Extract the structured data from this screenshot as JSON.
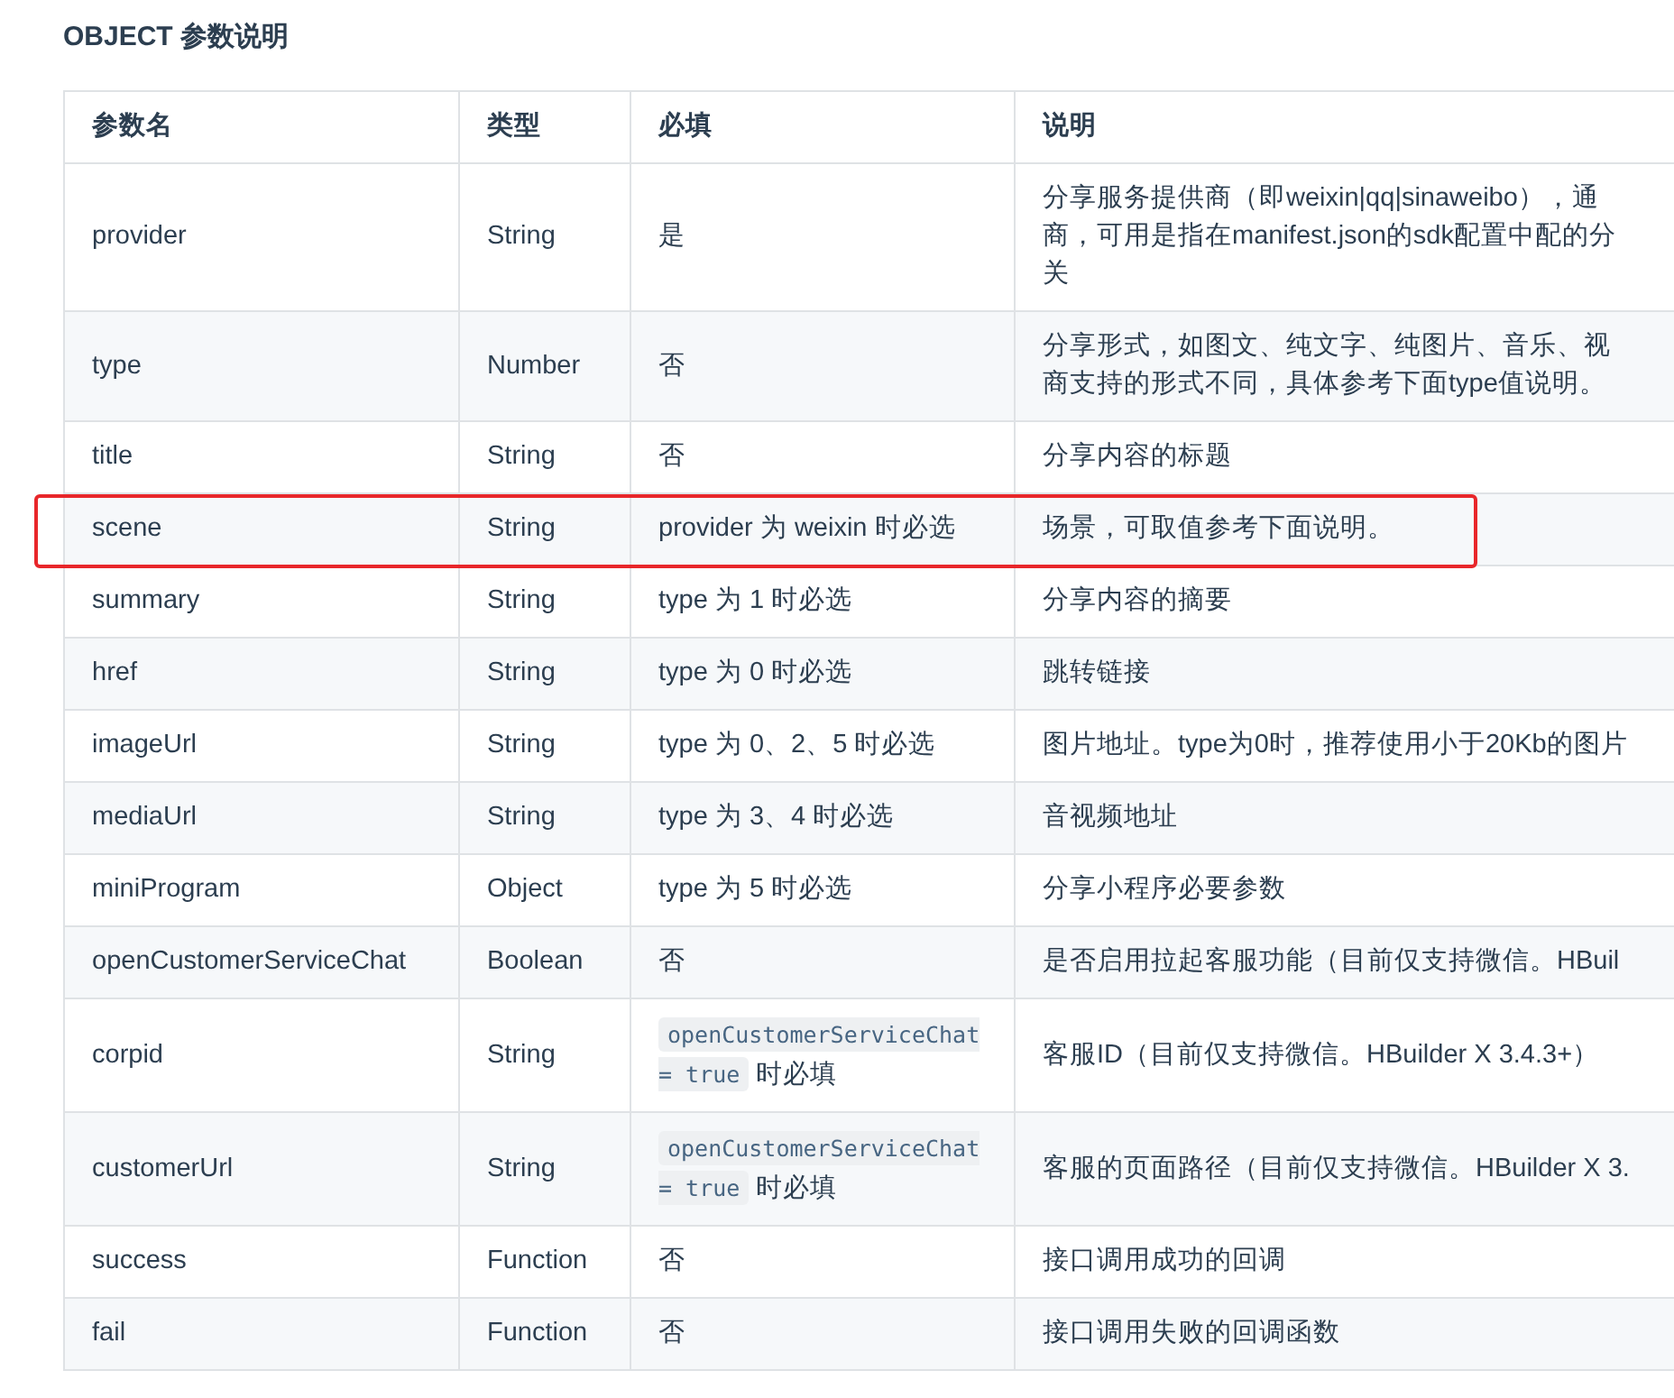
{
  "title": "OBJECT 参数说明",
  "columns": [
    "参数名",
    "类型",
    "必填",
    "说明"
  ],
  "rows": [
    {
      "name": "provider",
      "type": "String",
      "required": {
        "kind": "text",
        "text": "是"
      },
      "description": [
        "分享服务提供商（即weixin|qq|sinaweibo），通",
        "商，可用是指在manifest.json的sdk配置中配的分",
        "关"
      ],
      "highlighted": false
    },
    {
      "name": "type",
      "type": "Number",
      "required": {
        "kind": "text",
        "text": "否"
      },
      "description": [
        "分享形式，如图文、纯文字、纯图片、音乐、视",
        "商支持的形式不同，具体参考下面type值说明。"
      ],
      "highlighted": false
    },
    {
      "name": "title",
      "type": "String",
      "required": {
        "kind": "text",
        "text": "否"
      },
      "description": [
        "分享内容的标题"
      ],
      "highlighted": false
    },
    {
      "name": "scene",
      "type": "String",
      "required": {
        "kind": "text",
        "text": "provider 为 weixin 时必选"
      },
      "description": [
        "场景，可取值参考下面说明。"
      ],
      "highlighted": true
    },
    {
      "name": "summary",
      "type": "String",
      "required": {
        "kind": "text",
        "text": "type 为 1 时必选"
      },
      "description": [
        "分享内容的摘要"
      ],
      "highlighted": false
    },
    {
      "name": "href",
      "type": "String",
      "required": {
        "kind": "text",
        "text": "type 为 0 时必选"
      },
      "description": [
        "跳转链接"
      ],
      "highlighted": false
    },
    {
      "name": "imageUrl",
      "type": "String",
      "required": {
        "kind": "text",
        "text": "type 为 0、2、5 时必选"
      },
      "description": [
        "图片地址。type为0时，推荐使用小于20Kb的图片"
      ],
      "highlighted": false
    },
    {
      "name": "mediaUrl",
      "type": "String",
      "required": {
        "kind": "text",
        "text": "type 为 3、4 时必选"
      },
      "description": [
        "音视频地址"
      ],
      "highlighted": false
    },
    {
      "name": "miniProgram",
      "type": "Object",
      "required": {
        "kind": "text",
        "text": "type 为 5 时必选"
      },
      "description": [
        "分享小程序必要参数"
      ],
      "highlighted": false
    },
    {
      "name": "openCustomerServiceChat",
      "type": "Boolean",
      "required": {
        "kind": "text",
        "text": "否"
      },
      "description": [
        "是否启用拉起客服功能（目前仅支持微信。HBuil"
      ],
      "highlighted": false
    },
    {
      "name": "corpid",
      "type": "String",
      "required": {
        "kind": "code",
        "code": "openCustomerServiceChat = true",
        "text": "时必填"
      },
      "description": [
        "客服ID（目前仅支持微信。HBuilder X 3.4.3+）"
      ],
      "highlighted": false
    },
    {
      "name": "customerUrl",
      "type": "String",
      "required": {
        "kind": "code",
        "code": "openCustomerServiceChat = true",
        "text": "时必填"
      },
      "description": [
        "客服的页面路径（目前仅支持微信。HBuilder X 3."
      ],
      "highlighted": false
    },
    {
      "name": "success",
      "type": "Function",
      "required": {
        "kind": "text",
        "text": "否"
      },
      "description": [
        "接口调用成功的回调"
      ],
      "highlighted": false
    },
    {
      "name": "fail",
      "type": "Function",
      "required": {
        "kind": "text",
        "text": "否"
      },
      "description": [
        "接口调用失败的回调函数"
      ],
      "highlighted": false
    }
  ]
}
